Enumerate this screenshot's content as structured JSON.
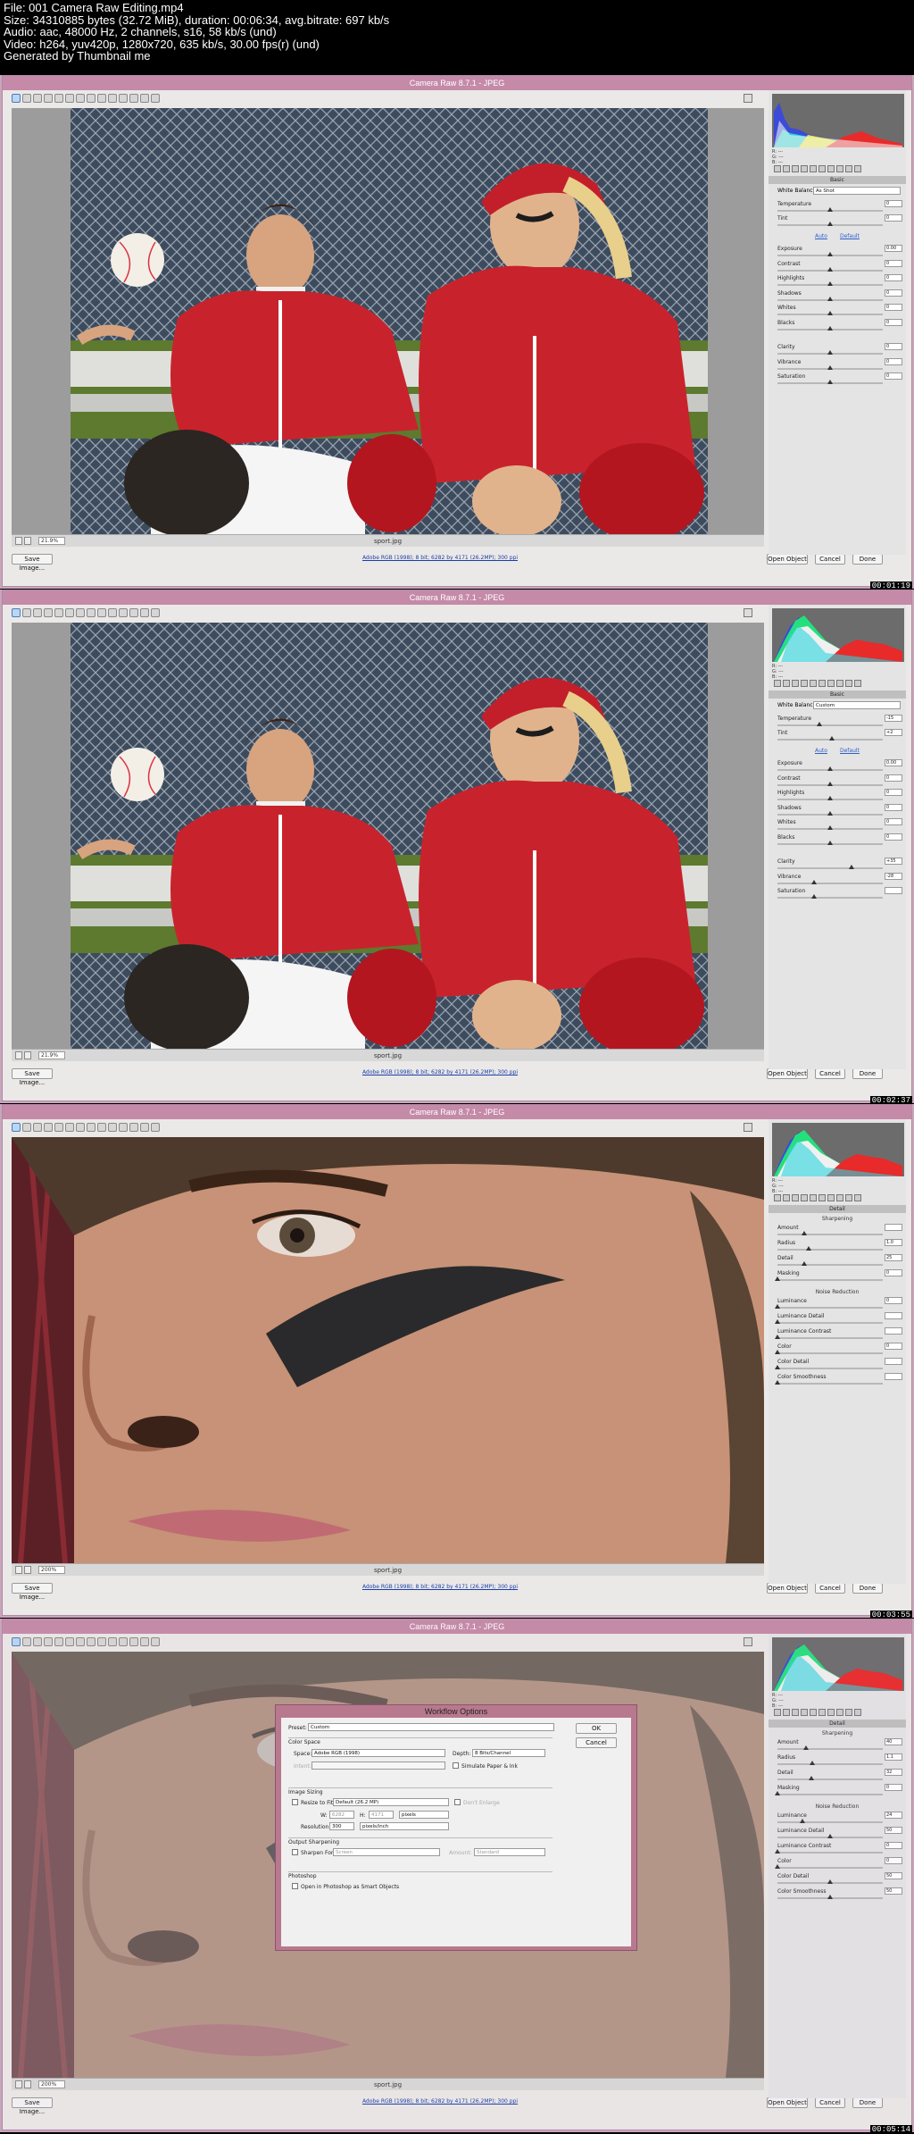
{
  "header": {
    "lines": [
      "File: 001 Camera Raw Editing.mp4",
      "Size: 34310885 bytes (32.72 MiB), duration: 00:06:34, avg.bitrate: 697 kb/s",
      "Audio: aac, 48000 Hz, 2 channels, s16, 58 kb/s (und)",
      "Video: h264, yuv420p, 1280x720, 635 kb/s, 30.00 fps(r) (und)",
      "Generated by Thumbnail me"
    ]
  },
  "app": {
    "title": "Camera Raw 8.7.1  -  JPEG",
    "filename": "sport.jpg",
    "workflow_link": "Adobe RGB (1998); 8 bit; 6282 by 4171 (26.2MP); 300 ppi",
    "save_label": "Save Image...",
    "open_label": "Open Object",
    "cancel_label": "Cancel",
    "done_label": "Done",
    "rgb_labels": [
      "R: ---",
      "G: ---",
      "B: ---"
    ]
  },
  "frames": [
    {
      "timestamp": "00:01:19",
      "zoom": "21.9%",
      "panel_title": "Basic",
      "wb_label": "White Balance:",
      "wb_value": "As Shot",
      "auto_label": "Auto",
      "default_label": "Default",
      "rows": [
        {
          "label": "Temperature",
          "value": "0",
          "pos": 0.5
        },
        {
          "label": "Tint",
          "value": "0",
          "pos": 0.5
        },
        {
          "label": "Exposure",
          "value": "0.00",
          "pos": 0.5
        },
        {
          "label": "Contrast",
          "value": "0",
          "pos": 0.5
        },
        {
          "label": "Highlights",
          "value": "0",
          "pos": 0.5
        },
        {
          "label": "Shadows",
          "value": "0",
          "pos": 0.5
        },
        {
          "label": "Whites",
          "value": "0",
          "pos": 0.5
        },
        {
          "label": "Blacks",
          "value": "0",
          "pos": 0.5
        },
        {
          "label": "Clarity",
          "value": "0",
          "pos": 0.5
        },
        {
          "label": "Vibrance",
          "value": "0",
          "pos": 0.5
        },
        {
          "label": "Saturation",
          "value": "0",
          "pos": 0.5
        }
      ]
    },
    {
      "timestamp": "00:02:37",
      "zoom": "21.9%",
      "panel_title": "Basic",
      "wb_label": "White Balance:",
      "wb_value": "Custom",
      "auto_label": "Auto",
      "default_label": "Default",
      "rows": [
        {
          "label": "Temperature",
          "value": "-15",
          "pos": 0.4
        },
        {
          "label": "Tint",
          "value": "+2",
          "pos": 0.52
        },
        {
          "label": "Exposure",
          "value": "0.00",
          "pos": 0.5
        },
        {
          "label": "Contrast",
          "value": "0",
          "pos": 0.5
        },
        {
          "label": "Highlights",
          "value": "0",
          "pos": 0.5
        },
        {
          "label": "Shadows",
          "value": "0",
          "pos": 0.5
        },
        {
          "label": "Whites",
          "value": "0",
          "pos": 0.5
        },
        {
          "label": "Blacks",
          "value": "0",
          "pos": 0.5
        },
        {
          "label": "Clarity",
          "value": "+35",
          "pos": 0.7
        },
        {
          "label": "Vibrance",
          "value": "-28",
          "pos": 0.35
        },
        {
          "label": "Saturation",
          "value": "",
          "pos": 0.35
        }
      ]
    },
    {
      "timestamp": "00:03:55",
      "zoom": "200%",
      "panel_title": "Detail",
      "sharpen_title": "Sharpening",
      "sharpen_rows": [
        {
          "label": "Amount",
          "value": "",
          "pos": 0.25
        },
        {
          "label": "Radius",
          "value": "1.0",
          "pos": 0.3
        },
        {
          "label": "Detail",
          "value": "25",
          "pos": 0.25
        },
        {
          "label": "Masking",
          "value": "0",
          "pos": 0.0
        }
      ],
      "noise_title": "Noise Reduction",
      "noise_rows": [
        {
          "label": "Luminance",
          "value": "0",
          "pos": 0.0
        },
        {
          "label": "Luminance Detail",
          "value": "",
          "pos": 0.0
        },
        {
          "label": "Luminance Contrast",
          "value": "",
          "pos": 0.0
        },
        {
          "label": "Color",
          "value": "0",
          "pos": 0.0
        },
        {
          "label": "Color Detail",
          "value": "",
          "pos": 0.0
        },
        {
          "label": "Color Smoothness",
          "value": "",
          "pos": 0.0
        }
      ]
    },
    {
      "timestamp": "00:05:14",
      "zoom": "200%",
      "panel_title": "Detail",
      "sharpen_title": "Sharpening",
      "sharpen_rows": [
        {
          "label": "Amount",
          "value": "40",
          "pos": 0.27
        },
        {
          "label": "Radius",
          "value": "1.1",
          "pos": 0.33
        },
        {
          "label": "Detail",
          "value": "32",
          "pos": 0.32
        },
        {
          "label": "Masking",
          "value": "0",
          "pos": 0.0
        }
      ],
      "noise_title": "Noise Reduction",
      "noise_rows": [
        {
          "label": "Luminance",
          "value": "24",
          "pos": 0.24
        },
        {
          "label": "Luminance Detail",
          "value": "50",
          "pos": 0.5
        },
        {
          "label": "Luminance Contrast",
          "value": "0",
          "pos": 0.0
        },
        {
          "label": "Color",
          "value": "0",
          "pos": 0.0
        },
        {
          "label": "Color Detail",
          "value": "50",
          "pos": 0.5
        },
        {
          "label": "Color Smoothness",
          "value": "50",
          "pos": 0.5
        }
      ]
    }
  ],
  "dialog": {
    "title": "Workflow Options",
    "preset_label": "Preset:",
    "preset_value": "Custom",
    "ok_label": "OK",
    "cancel_label": "Cancel",
    "color_space": {
      "title": "Color Space",
      "space_label": "Space:",
      "space_value": "Adobe RGB (1998)",
      "depth_label": "Depth:",
      "depth_value": "8 Bits/Channel",
      "intent_label": "Intent:",
      "simulate_label": "Simulate Paper & Ink"
    },
    "sizing": {
      "title": "Image Sizing",
      "resize_label": "Resize to Fit:",
      "resize_value": "Default  (26.2 MP)",
      "enlarge_label": "Don't Enlarge",
      "w_label": "W:",
      "w_value": "6282",
      "h_label": "H:",
      "h_value": "4171",
      "units_value": "pixels",
      "res_label": "Resolution:",
      "res_value": "300",
      "res_units": "pixels/inch"
    },
    "sharpening": {
      "title": "Output Sharpening",
      "sharpen_label": "Sharpen For:",
      "sharpen_value": "Screen",
      "amount_label": "Amount:",
      "amount_value": "Standard"
    },
    "photoshop": {
      "title": "Photoshop",
      "smart_label": "Open in Photoshop as Smart Objects"
    }
  },
  "colors": {
    "title_bar": "#c48aa8",
    "frame_border": "#c9a4bd",
    "link": "#1b3ea8",
    "accent_jersey": "#c8232c"
  }
}
